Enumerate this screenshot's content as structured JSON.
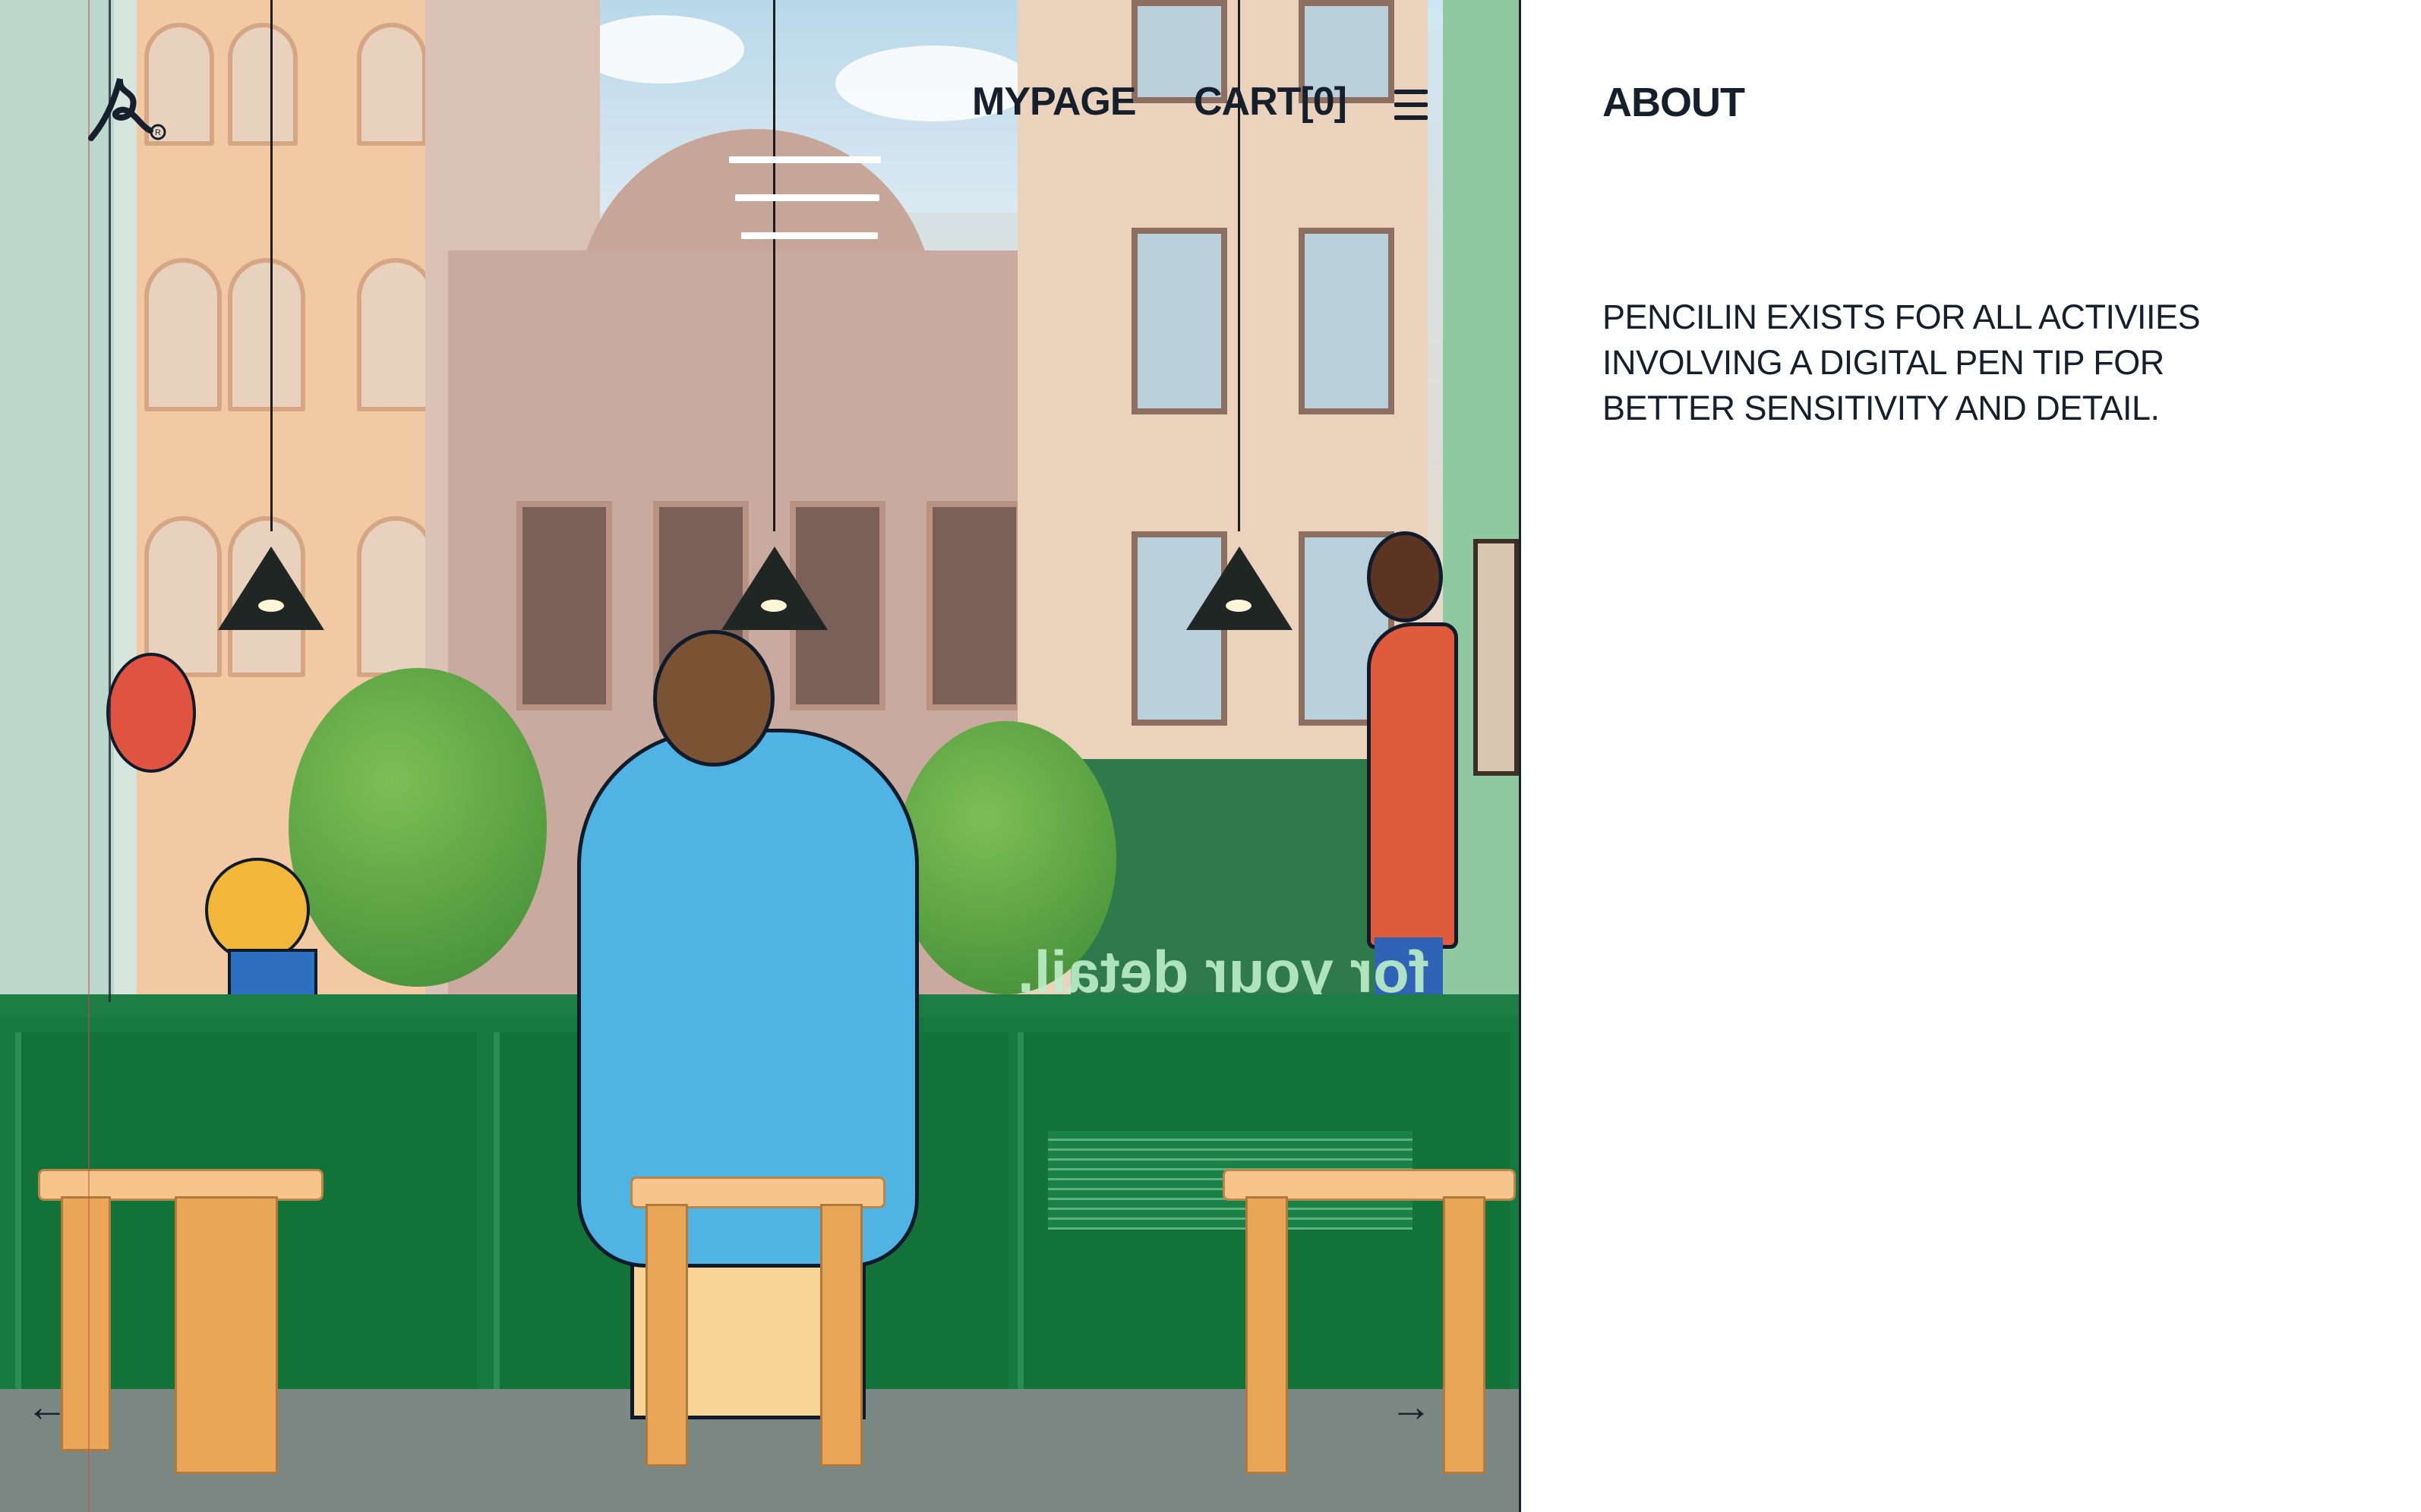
{
  "header": {
    "logo_icon": "pencilin-signature-logo",
    "nav": [
      {
        "label": "MYPAGE"
      },
      {
        "label": "CART[0]"
      }
    ],
    "menu_icon": "hamburger-menu-icon"
  },
  "hero": {
    "illustration": "cafe-window-scene",
    "glass_text": "for your detail.",
    "prev_icon": "arrow-left-icon",
    "next_icon": "arrow-right-icon",
    "prev_glyph": "←",
    "next_glyph": "→"
  },
  "about": {
    "title": "ABOUT",
    "body": "PENCILIN EXISTS FOR ALL ACTIVIIES INVOLVING A DIGITAL PEN TIP FOR BETTER SENSITIVITY AND DETAIL."
  },
  "colors": {
    "text": "#16202c",
    "counter_green": "#16793f",
    "shirt_blue": "#4fb3e3",
    "accent_red": "#e05a3c"
  }
}
